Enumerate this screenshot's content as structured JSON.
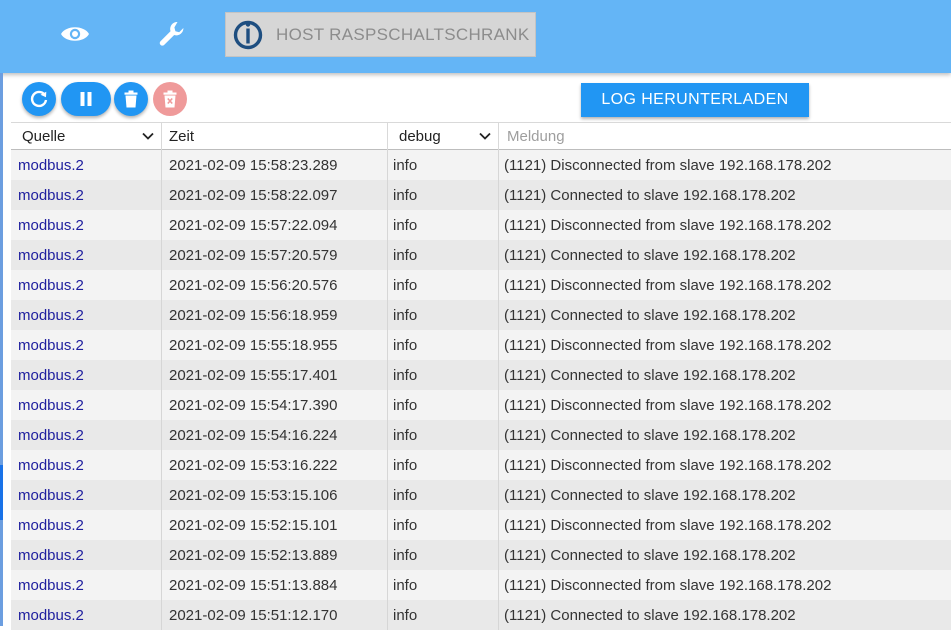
{
  "topbar": {
    "host_label": "HOST RASPSCHALTSCHRANK",
    "icons": [
      "eye-icon",
      "wrench-icon",
      "iobroker-logo"
    ],
    "background": "#64b5f6"
  },
  "toolbar": {
    "buttons": [
      "refresh-icon",
      "pause-icon",
      "delete-icon",
      "clear-disabled-icon"
    ],
    "download_label": "LOG HERUNTERLADEN",
    "accent": "#2196f3",
    "disabled_color": "#ef9a9a"
  },
  "table": {
    "columns": {
      "source": "Quelle",
      "time": "Zeit",
      "level": "debug",
      "message_placeholder": "Meldung"
    },
    "rows": [
      {
        "source": "modbus.2",
        "time": "2021-02-09 15:58:23.289",
        "level": "info",
        "message": "(1121) Disconnected from slave 192.168.178.202"
      },
      {
        "source": "modbus.2",
        "time": "2021-02-09 15:58:22.097",
        "level": "info",
        "message": "(1121) Connected to slave 192.168.178.202"
      },
      {
        "source": "modbus.2",
        "time": "2021-02-09 15:57:22.094",
        "level": "info",
        "message": "(1121) Disconnected from slave 192.168.178.202"
      },
      {
        "source": "modbus.2",
        "time": "2021-02-09 15:57:20.579",
        "level": "info",
        "message": "(1121) Connected to slave 192.168.178.202"
      },
      {
        "source": "modbus.2",
        "time": "2021-02-09 15:56:20.576",
        "level": "info",
        "message": "(1121) Disconnected from slave 192.168.178.202"
      },
      {
        "source": "modbus.2",
        "time": "2021-02-09 15:56:18.959",
        "level": "info",
        "message": "(1121) Connected to slave 192.168.178.202"
      },
      {
        "source": "modbus.2",
        "time": "2021-02-09 15:55:18.955",
        "level": "info",
        "message": "(1121) Disconnected from slave 192.168.178.202"
      },
      {
        "source": "modbus.2",
        "time": "2021-02-09 15:55:17.401",
        "level": "info",
        "message": "(1121) Connected to slave 192.168.178.202"
      },
      {
        "source": "modbus.2",
        "time": "2021-02-09 15:54:17.390",
        "level": "info",
        "message": "(1121) Disconnected from slave 192.168.178.202"
      },
      {
        "source": "modbus.2",
        "time": "2021-02-09 15:54:16.224",
        "level": "info",
        "message": "(1121) Connected to slave 192.168.178.202"
      },
      {
        "source": "modbus.2",
        "time": "2021-02-09 15:53:16.222",
        "level": "info",
        "message": "(1121) Disconnected from slave 192.168.178.202"
      },
      {
        "source": "modbus.2",
        "time": "2021-02-09 15:53:15.106",
        "level": "info",
        "message": "(1121) Connected to slave 192.168.178.202"
      },
      {
        "source": "modbus.2",
        "time": "2021-02-09 15:52:15.101",
        "level": "info",
        "message": "(1121) Disconnected from slave 192.168.178.202"
      },
      {
        "source": "modbus.2",
        "time": "2021-02-09 15:52:13.889",
        "level": "info",
        "message": "(1121) Connected to slave 192.168.178.202"
      },
      {
        "source": "modbus.2",
        "time": "2021-02-09 15:51:13.884",
        "level": "info",
        "message": "(1121) Disconnected from slave 192.168.178.202"
      },
      {
        "source": "modbus.2",
        "time": "2021-02-09 15:51:12.170",
        "level": "info",
        "message": "(1121) Connected to slave 192.168.178.202"
      }
    ]
  }
}
